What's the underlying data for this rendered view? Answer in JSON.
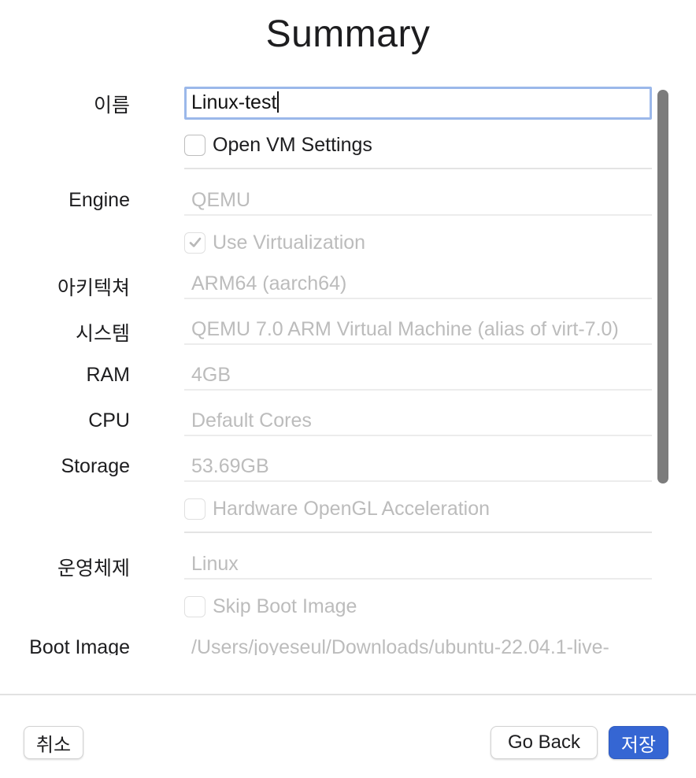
{
  "title": "Summary",
  "form": {
    "name": {
      "label": "이름",
      "value": "Linux-test"
    },
    "open_vm_settings": {
      "label": "Open VM Settings",
      "checked": false
    },
    "engine": {
      "label": "Engine",
      "value": "QEMU"
    },
    "use_virtualization": {
      "label": "Use Virtualization",
      "checked": true
    },
    "architecture": {
      "label": "아키텍쳐",
      "value": "ARM64 (aarch64)"
    },
    "system": {
      "label": "시스템",
      "value": "QEMU 7.0 ARM Virtual Machine (alias of virt-7.0)"
    },
    "ram": {
      "label": "RAM",
      "value": "4GB"
    },
    "cpu": {
      "label": "CPU",
      "value": "Default Cores"
    },
    "storage": {
      "label": "Storage",
      "value": "53.69GB"
    },
    "hw_opengl": {
      "label": "Hardware OpenGL Acceleration",
      "checked": false
    },
    "os": {
      "label": "운영체제",
      "value": "Linux"
    },
    "skip_boot_image": {
      "label": "Skip Boot Image",
      "checked": false
    },
    "boot_image": {
      "label": "Boot Image",
      "value": "/Users/joyeseul/Downloads/ubuntu-22.04.1-live-"
    }
  },
  "footer": {
    "cancel_label": "취소",
    "go_back_label": "Go Back",
    "save_label": "저장"
  },
  "colors": {
    "accent": "#3566d3",
    "focus_ring": "#9bb8ea",
    "disabled_text": "#bcbcbc",
    "scroll_thumb": "#7c7c7c"
  },
  "icons": {
    "checkmark": "checkmark-icon"
  }
}
